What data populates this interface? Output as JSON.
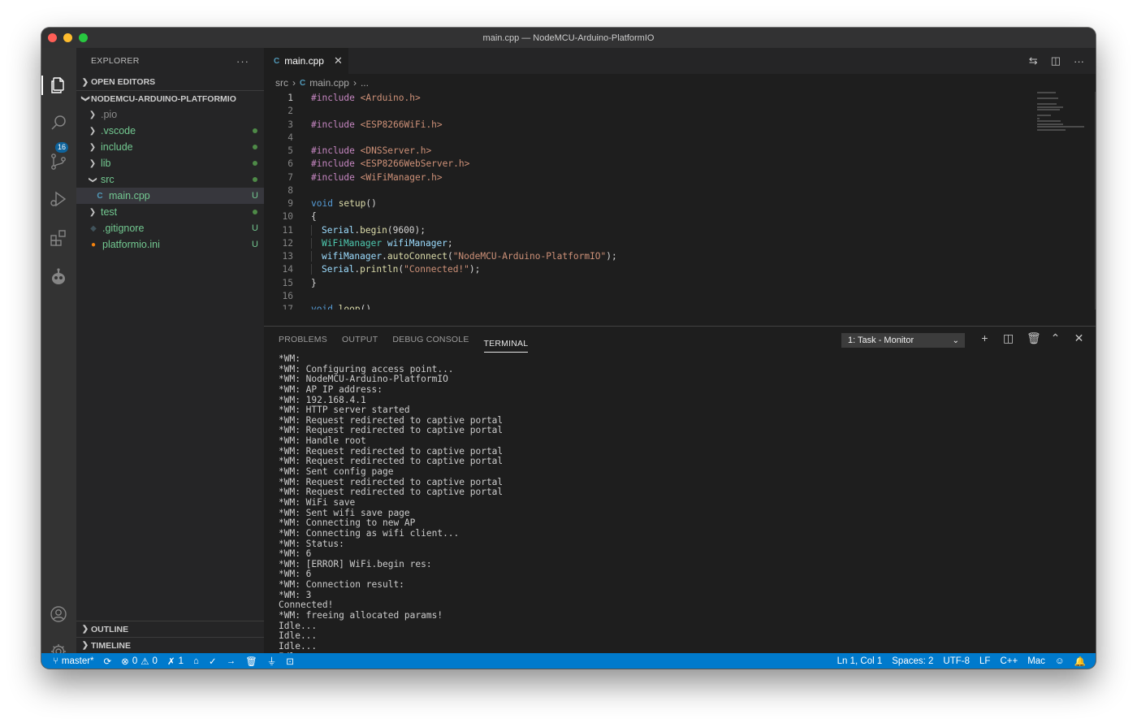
{
  "window": {
    "title": "main.cpp — NodeMCU-Arduino-PlatformIO"
  },
  "activity": {
    "scm_badge": "16"
  },
  "explorer": {
    "title": "EXPLORER",
    "more": "···",
    "open_editors": "OPEN EDITORS",
    "project": "NODEMCU-ARDUINO-PLATFORMIO",
    "items": [
      {
        "name": ".pio",
        "type": "folder",
        "status": ""
      },
      {
        "name": ".vscode",
        "type": "folder",
        "status": "dot"
      },
      {
        "name": "include",
        "type": "folder",
        "status": "dot"
      },
      {
        "name": "lib",
        "type": "folder",
        "status": "dot"
      },
      {
        "name": "src",
        "type": "folder-open",
        "status": "dot"
      },
      {
        "name": "main.cpp",
        "type": "file-cpp",
        "status": "U"
      },
      {
        "name": "test",
        "type": "folder",
        "status": "dot"
      },
      {
        "name": ".gitignore",
        "type": "file-git",
        "status": "U"
      },
      {
        "name": "platformio.ini",
        "type": "file-pio",
        "status": "U"
      }
    ],
    "outline": "OUTLINE",
    "timeline": "TIMELINE"
  },
  "editor": {
    "tab_label": "main.cpp",
    "tab_icon": "C",
    "breadcrumb": {
      "folder": "src",
      "file": "main.cpp",
      "rest": "..."
    },
    "lines": [
      {
        "n": "1",
        "parts": [
          [
            "k-inc",
            "#include "
          ],
          [
            "k-str",
            "<Arduino.h>"
          ]
        ]
      },
      {
        "n": "2",
        "parts": []
      },
      {
        "n": "3",
        "parts": [
          [
            "k-inc",
            "#include "
          ],
          [
            "k-str",
            "<ESP8266WiFi.h>"
          ]
        ]
      },
      {
        "n": "4",
        "parts": []
      },
      {
        "n": "5",
        "parts": [
          [
            "k-inc",
            "#include "
          ],
          [
            "k-str",
            "<DNSServer.h>"
          ]
        ]
      },
      {
        "n": "6",
        "parts": [
          [
            "k-inc",
            "#include "
          ],
          [
            "k-str",
            "<ESP8266WebServer.h>"
          ]
        ]
      },
      {
        "n": "7",
        "parts": [
          [
            "k-inc",
            "#include "
          ],
          [
            "k-str",
            "<WiFiManager.h>"
          ]
        ]
      },
      {
        "n": "8",
        "parts": []
      },
      {
        "n": "9",
        "parts": [
          [
            "k-kw",
            "void "
          ],
          [
            "k-fn",
            "setup"
          ],
          [
            "",
            "()"
          ]
        ]
      },
      {
        "n": "10",
        "parts": [
          [
            "",
            "{"
          ]
        ]
      },
      {
        "n": "11",
        "indent": true,
        "parts": [
          [
            "k-var",
            "Serial"
          ],
          [
            "",
            "."
          ],
          [
            "k-fn",
            "begin"
          ],
          [
            "",
            "(9600);"
          ]
        ]
      },
      {
        "n": "12",
        "indent": true,
        "parts": [
          [
            "k-type",
            "WiFiManager "
          ],
          [
            "k-var",
            "wifiManager"
          ],
          [
            "",
            ";"
          ]
        ]
      },
      {
        "n": "13",
        "indent": true,
        "parts": [
          [
            "k-var",
            "wifiManager"
          ],
          [
            "",
            "."
          ],
          [
            "k-fn",
            "autoConnect"
          ],
          [
            "",
            "("
          ],
          [
            "k-str",
            "\"NodeMCU-Arduino-PlatformIO\""
          ],
          [
            "",
            ");"
          ]
        ]
      },
      {
        "n": "14",
        "indent": true,
        "parts": [
          [
            "k-var",
            "Serial"
          ],
          [
            "",
            "."
          ],
          [
            "k-fn",
            "println"
          ],
          [
            "",
            "("
          ],
          [
            "k-str",
            "\"Connected!\""
          ],
          [
            "",
            ");"
          ]
        ]
      },
      {
        "n": "15",
        "parts": [
          [
            "",
            "}"
          ]
        ]
      },
      {
        "n": "16",
        "parts": []
      },
      {
        "n": "17",
        "parts": [
          [
            "k-kw",
            "void "
          ],
          [
            "k-fn",
            "loop"
          ],
          [
            "",
            "()"
          ]
        ]
      }
    ]
  },
  "panel": {
    "tabs": [
      "PROBLEMS",
      "OUTPUT",
      "DEBUG CONSOLE",
      "TERMINAL"
    ],
    "active_tab": "TERMINAL",
    "terminal_select": "1: Task - Monitor",
    "terminal_lines": [
      "*WM:",
      "*WM: Configuring access point...",
      "*WM: NodeMCU-Arduino-PlatformIO",
      "*WM: AP IP address:",
      "*WM: 192.168.4.1",
      "*WM: HTTP server started",
      "*WM: Request redirected to captive portal",
      "*WM: Request redirected to captive portal",
      "*WM: Handle root",
      "*WM: Request redirected to captive portal",
      "*WM: Request redirected to captive portal",
      "*WM: Sent config page",
      "*WM: Request redirected to captive portal",
      "*WM: Request redirected to captive portal",
      "*WM: WiFi save",
      "*WM: Sent wifi save page",
      "*WM: Connecting to new AP",
      "*WM: Connecting as wifi client...",
      "*WM: Status:",
      "*WM: 6",
      "*WM: [ERROR] WiFi.begin res:",
      "*WM: 6",
      "*WM: Connection result:",
      "*WM: 3",
      "Connected!",
      "*WM: freeing allocated params!",
      "Idle...",
      "Idle...",
      "Idle...",
      "Idle..."
    ]
  },
  "status": {
    "branch": "master*",
    "errors": "0",
    "warnings": "0",
    "ports": "1",
    "position": "Ln 1, Col 1",
    "spaces": "Spaces: 2",
    "encoding": "UTF-8",
    "eol": "LF",
    "language": "C++",
    "os": "Mac"
  }
}
